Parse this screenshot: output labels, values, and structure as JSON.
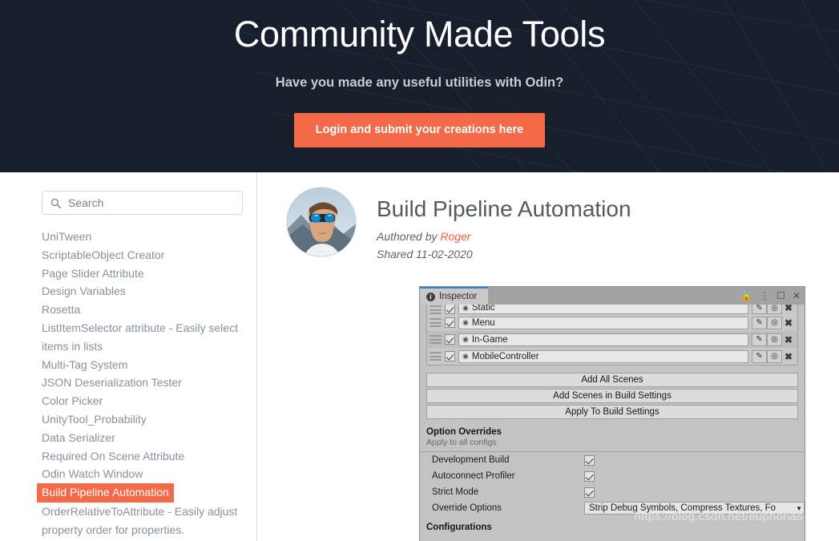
{
  "hero": {
    "title": "Community Made Tools",
    "subtitle": "Have you made any useful utilities with Odin?",
    "cta_label": "Login and submit your creations here",
    "background_color": "#161f2b",
    "accent_color": "#f46a48"
  },
  "sidebar": {
    "search": {
      "placeholder": "Search",
      "value": "",
      "icon": "search-icon"
    },
    "items": [
      {
        "label": "UniTween",
        "selected": false
      },
      {
        "label": "ScriptableObject Creator",
        "selected": false
      },
      {
        "label": "Page Slider Attribute",
        "selected": false
      },
      {
        "label": "Design Variables",
        "selected": false
      },
      {
        "label": "Rosetta",
        "selected": false
      },
      {
        "label": "ListItemSelector attribute - Easily select items in lists",
        "selected": false
      },
      {
        "label": "Multi-Tag System",
        "selected": false
      },
      {
        "label": "JSON Deserialization Tester",
        "selected": false
      },
      {
        "label": "Color Picker",
        "selected": false
      },
      {
        "label": "UnityTool_Probability",
        "selected": false
      },
      {
        "label": "Data Serializer",
        "selected": false
      },
      {
        "label": "Required On Scene Attribute",
        "selected": false
      },
      {
        "label": "Odin Watch Window",
        "selected": false
      },
      {
        "label": "Build Pipeline Automation",
        "selected": true
      },
      {
        "label": "OrderRelativeToAttribute - Easily adjust property order for properties.",
        "selected": false
      }
    ]
  },
  "post": {
    "title": "Build Pipeline Automation",
    "authored_by_prefix": "Authored by ",
    "author": "Roger",
    "shared": "Shared 11-02-2020",
    "avatar_alt": "avatar"
  },
  "inspector": {
    "tab_label": "Inspector",
    "tab_icon": "info-icon",
    "titlebar_icons": [
      "lock-icon",
      "kebab-menu-icon",
      "maximize-icon",
      "close-icon"
    ],
    "scene_rows": [
      {
        "name": "Static",
        "enabled": true,
        "clipped": true
      },
      {
        "name": "Menu",
        "enabled": true,
        "clipped": false
      },
      {
        "name": "In-Game",
        "enabled": true,
        "clipped": false
      },
      {
        "name": "MobileController",
        "enabled": true,
        "clipped": false
      }
    ],
    "row_icons": [
      "pencil-icon",
      "target-icon",
      "remove-icon"
    ],
    "buttons": [
      "Add All Scenes",
      "Add Scenes in Build Settings",
      "Apply To Build Settings"
    ],
    "option_overrides": {
      "title": "Option Overrides",
      "subtitle": "Apply to all configs",
      "options": [
        {
          "label": "Development Build",
          "checked": true
        },
        {
          "label": "Autoconnect Profiler",
          "checked": true
        },
        {
          "label": "Strict Mode",
          "checked": true
        }
      ],
      "override_options_label": "Override Options",
      "override_options_value": "Strip Debug Symbols,  Compress Textures,  Fo"
    },
    "configurations_title": "Configurations"
  },
  "watermark": "https://blog.csdn.net/euphorias"
}
